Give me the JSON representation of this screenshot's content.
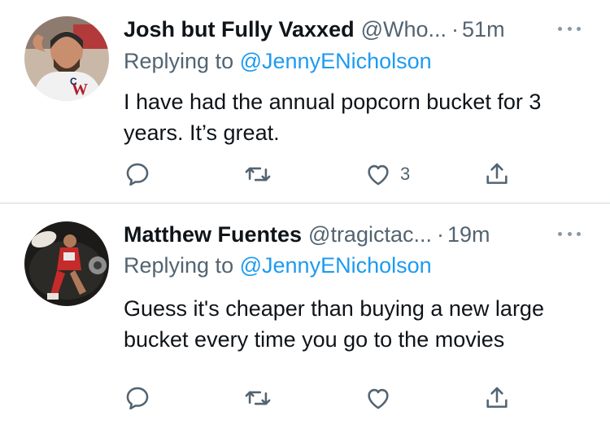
{
  "colors": {
    "accent": "#1d9bf0",
    "secondary_text": "#536471",
    "primary_text": "#0f1419",
    "divider": "#cfd9de"
  },
  "tweets": [
    {
      "name": "Josh but Fully Vaxxed",
      "handle": "@Who...",
      "dot": "·",
      "time": "51m",
      "replying_prefix": "Replying to",
      "replying_to": "@JennyENicholson",
      "text": "I have had the annual popcorn bucket for 3 years. It’s great.",
      "like_count": "3",
      "icons": [
        "reply-icon",
        "retweet-icon",
        "like-icon",
        "share-icon",
        "more-icon"
      ]
    },
    {
      "name": "Matthew Fuentes",
      "handle": "@tragictac...",
      "dot": "·",
      "time": "19m",
      "replying_prefix": "Replying to",
      "replying_to": "@JennyENicholson",
      "text": "Guess it's cheaper than buying a new large bucket every time you go to the movies",
      "like_count": "",
      "icons": [
        "reply-icon",
        "retweet-icon",
        "like-icon",
        "share-icon",
        "more-icon"
      ]
    }
  ]
}
